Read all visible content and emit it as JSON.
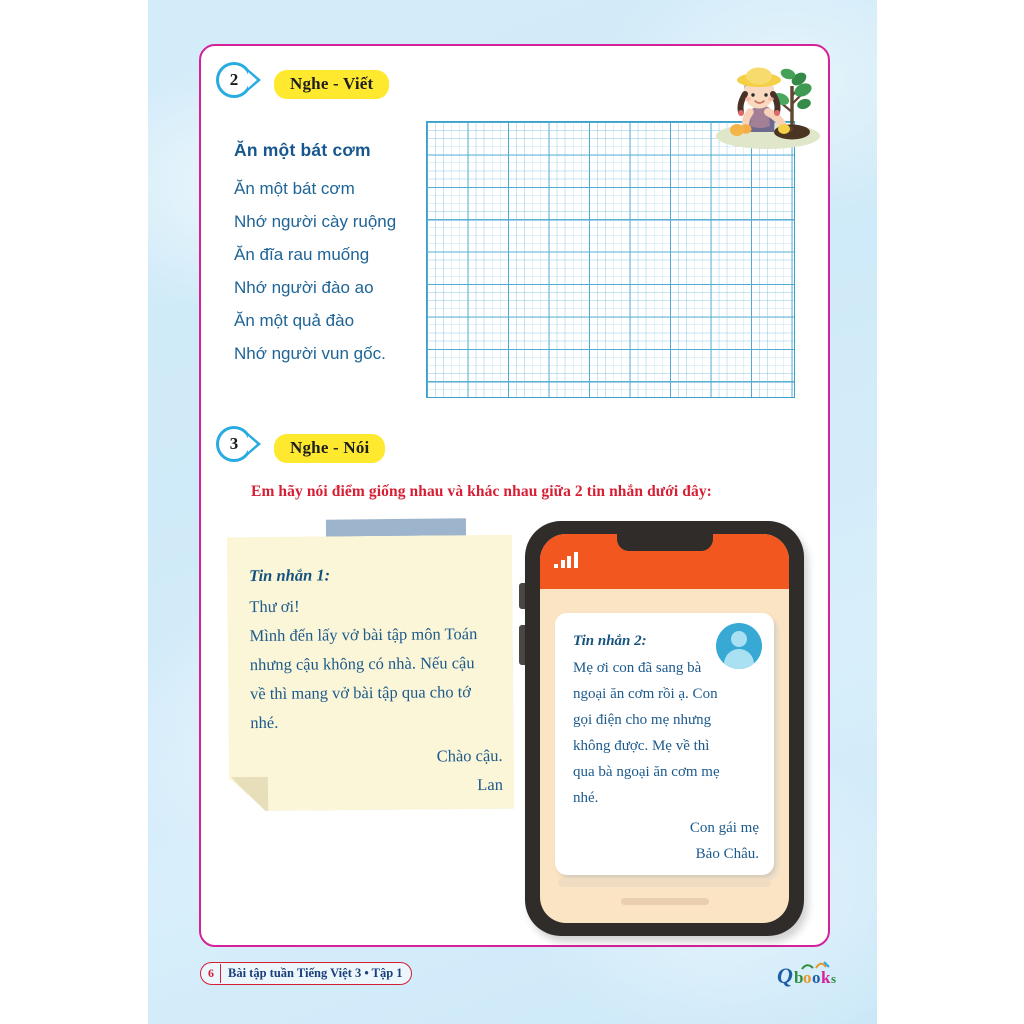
{
  "page": {
    "background_color": "#d3ecf9",
    "frame_color": "#d6229a"
  },
  "exercises": [
    {
      "number": "2",
      "label": "Nghe - Viết",
      "poem": {
        "title": "Ăn một bát cơm",
        "lines": [
          "Ăn một bát cơm",
          "Nhớ người cày ruộng",
          "Ăn đĩa rau muống",
          "Nhớ người đào ao",
          "Ăn một quả đào",
          "Nhớ người vun gốc."
        ]
      },
      "writing_grid": {
        "name": "writing-grid",
        "value": "",
        "grid_color": "#3aa0cc"
      },
      "illustration": "girl-planting-tree-icon"
    },
    {
      "number": "3",
      "label": "Nghe - Nói",
      "instruction": "Em hãy nói điểm giống nhau và khác nhau giữa 2 tin nhắn dưới đây:",
      "instruction_color": "#d61f35",
      "note": {
        "label": "Tin nhắn 1:",
        "lines": [
          "Thư ơi!",
          "Mình đến lấy vở bài tập môn Toán",
          "nhưng cậu không có nhà. Nếu cậu",
          "về thì mang vở bài tập qua cho tớ",
          "nhé."
        ],
        "signoff": "Chào cậu.",
        "sender": "Lan",
        "paper_color": "#fbf6d8",
        "tape_color": "#9db4cd"
      },
      "phone": {
        "status_bar_color": "#f2571f",
        "frame_color": "#302c2a",
        "screen_color": "#fbe4c4",
        "signal_icon": "signal-bars-icon",
        "avatar_icon": "user-avatar-icon",
        "message": {
          "label": "Tin nhắn 2:",
          "lines": [
            "Mẹ ơi con đã sang bà",
            "ngoại ăn cơm rồi ạ. Con",
            "gọi điện cho mẹ nhưng",
            "không được. Mẹ về thì",
            "qua bà ngoại ăn cơm mẹ",
            "nhé."
          ],
          "signoff": "Con gái mẹ",
          "sender": "Bảo Châu."
        }
      }
    }
  ],
  "footer": {
    "page_number": "6",
    "title": "Bài tập tuần Tiếng Việt 3 • Tập 1",
    "logo_text": "Qbooks",
    "accent_red": "#d61f35",
    "accent_blue": "#1a3f7a"
  }
}
